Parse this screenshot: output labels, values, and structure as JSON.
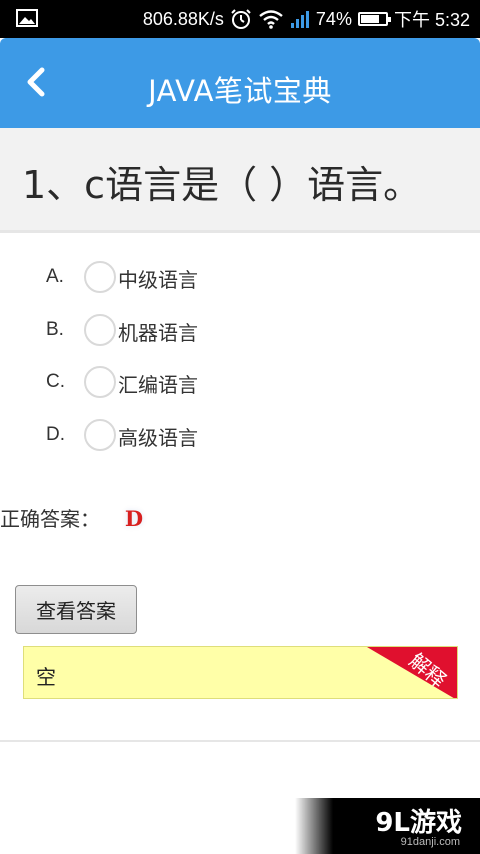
{
  "status_bar": {
    "network_speed": "806.88K/s",
    "battery_percent": "74%",
    "battery_level": 0.74,
    "time": "下午 5:32",
    "icons": [
      "image-icon",
      "alarm-icon",
      "wifi-icon",
      "signal-icon",
      "battery-icon"
    ]
  },
  "header": {
    "title": "JAVA笔试宝典",
    "background_color": "#3d9ae6",
    "back_icon": "chevron-left-icon"
  },
  "question": {
    "text": "1、c语言是（   ）语言。"
  },
  "options": [
    {
      "letter": "A.",
      "label": "中级语言"
    },
    {
      "letter": "B.",
      "label": "机器语言"
    },
    {
      "letter": "C.",
      "label": "汇编语言"
    },
    {
      "letter": "D.",
      "label": "高级语言"
    }
  ],
  "answer": {
    "label": "正确答案：",
    "value": "D",
    "value_color": "#d82020"
  },
  "view_answer_button": {
    "label": "查看答案"
  },
  "explanation": {
    "text": "空",
    "corner_label": "解释",
    "corner_color": "#e0102e",
    "background_color": "#ffffa8"
  },
  "watermark": {
    "brand": "9L游戏",
    "url": "91danji.com"
  }
}
